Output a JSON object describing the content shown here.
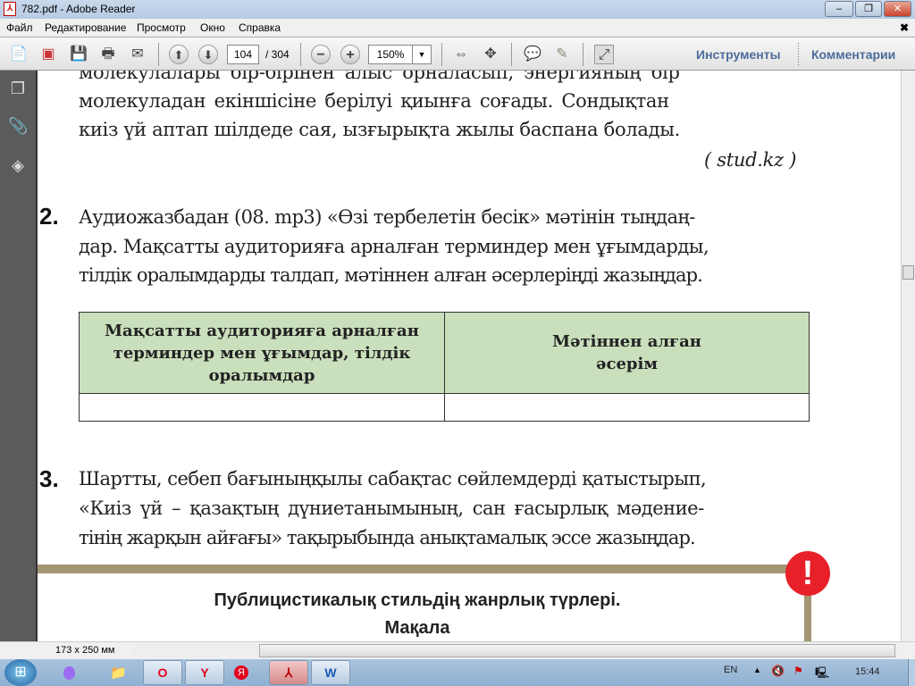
{
  "window": {
    "title": "782.pdf - Adobe Reader",
    "minimize": "‒",
    "restore": "❐",
    "close": "✕"
  },
  "menu": [
    "Файл",
    "Редактирование",
    "Просмотр",
    "Окно",
    "Справка"
  ],
  "toolbar": {
    "page_current": "104",
    "page_total": "/ 304",
    "zoom": "150%",
    "tools": "Инструменты",
    "comments": "Комментарии"
  },
  "document": {
    "paragraph1": [
      "молекулалары бір-бірінен алыс орналасып, энергияның бір",
      "молекуладан екіншісіне берілуі қиынға соғады. Сондықтан",
      "киіз үй аптап шілдеде сая, ызғырықта жылы баспана болады."
    ],
    "source": "( stud.kz )",
    "task2": {
      "number": "2.",
      "lines": [
        "Аудиожазбадан (08. mp3) «Өзі тербелетін бесік» мәтінін тыңдаң-",
        "дар. Мақсатты аудиторияға арналған терминдер мен ұғымдарды,",
        "тілдік оралымдарды талдап, мәтіннен алған әсерлеріңді жазыңдар."
      ]
    },
    "table": {
      "headers": [
        "Мақсатты аудиторияға арналған терминдер мен ұғымдар, тілдік оралымдар",
        "Мәтіннен алған әсерім"
      ],
      "rows": [
        [
          "",
          ""
        ]
      ]
    },
    "task3": {
      "number": "3.",
      "lines": [
        "Шартты, себеп бағыныңқылы сабақтас сөйлемдерді қатыстырып,",
        "«Киіз үй – қазақтың дүниетанымының, сан ғасырлық мәдение-",
        "тінің жарқын айғағы» тақырыбында анықтамалық эссе жазыңдар."
      ]
    },
    "section_heading": [
      "Публицистикалық стильдің жанрлық түрлері.",
      "Мақала"
    ],
    "alert_mark": "!"
  },
  "status": {
    "page_size": "173 x 250 мм"
  },
  "taskbar": {
    "lang": "EN",
    "time": "15:44",
    "apps": [
      "Opera",
      "Yandex Browser",
      "Яндекс",
      "Adobe Reader",
      "Word"
    ]
  },
  "colors": {
    "table_header": "#cadfbc",
    "divider": "#a39674",
    "alert": "#e8202a"
  }
}
